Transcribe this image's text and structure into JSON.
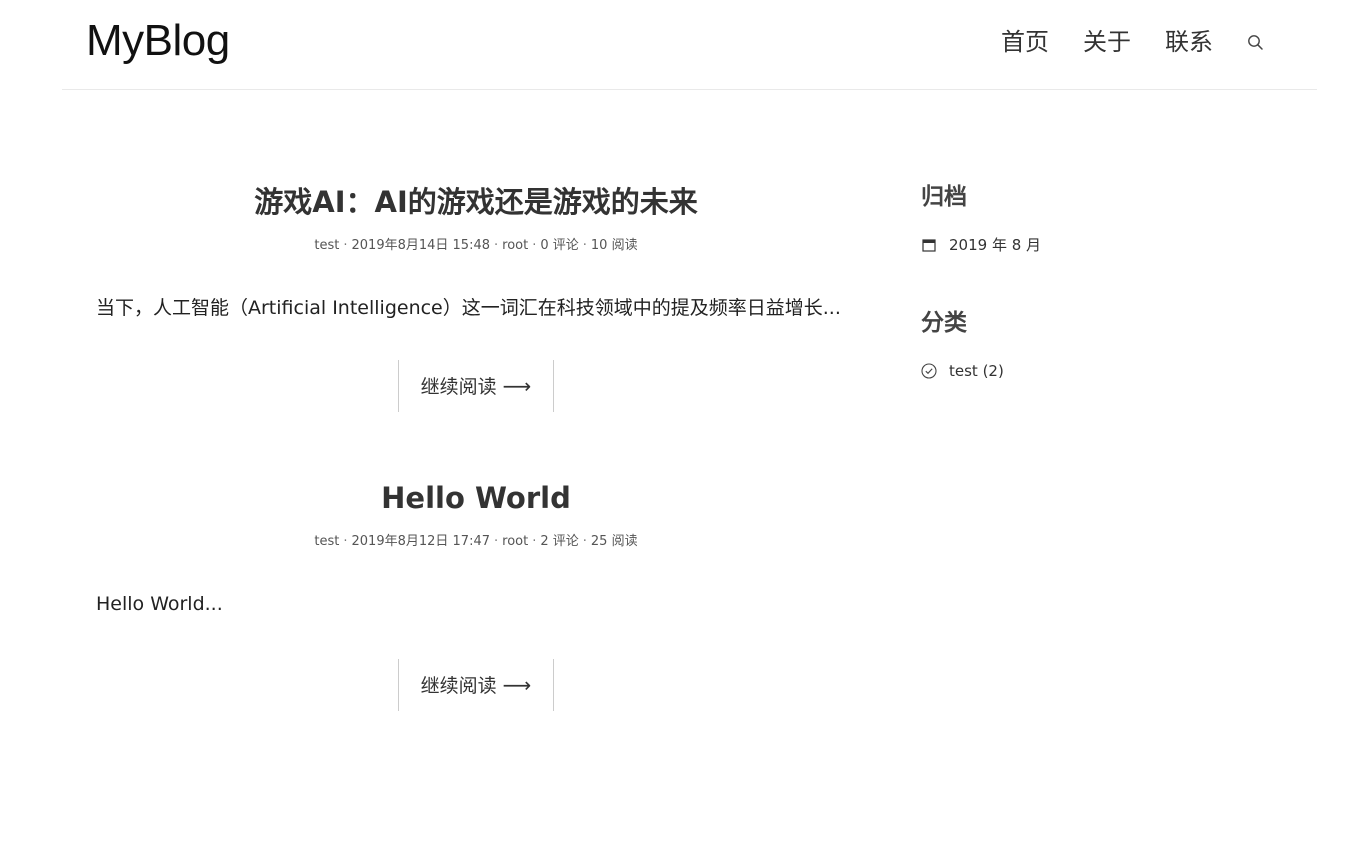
{
  "site": {
    "logo": "MyBlog"
  },
  "nav": {
    "items": [
      {
        "label": "首页"
      },
      {
        "label": "关于"
      },
      {
        "label": "联系"
      }
    ],
    "search_icon": "search-icon"
  },
  "posts": [
    {
      "title": "游戏AI：AI的游戏还是游戏的未来",
      "category": "test",
      "date": "2019年8月14日 15:48",
      "author": "root",
      "comments": "0 评论",
      "views": "10 阅读",
      "excerpt": "当下，人工智能（Artificial Intelligence）这一词汇在科技领域中的提及频率日益增长...",
      "read_more": "继续阅读"
    },
    {
      "title": "Hello World",
      "category": "test",
      "date": "2019年8月12日 17:47",
      "author": "root",
      "comments": "2 评论",
      "views": "25 阅读",
      "excerpt": "Hello World...",
      "read_more": "继续阅读"
    }
  ],
  "sidebar": {
    "archive": {
      "title": "归档",
      "items": [
        {
          "label": "2019 年 8 月",
          "icon": "calendar-icon"
        }
      ]
    },
    "categories": {
      "title": "分类",
      "items": [
        {
          "label": "test (2)",
          "icon": "check-circle-icon"
        }
      ]
    }
  },
  "arrow": "⟶"
}
